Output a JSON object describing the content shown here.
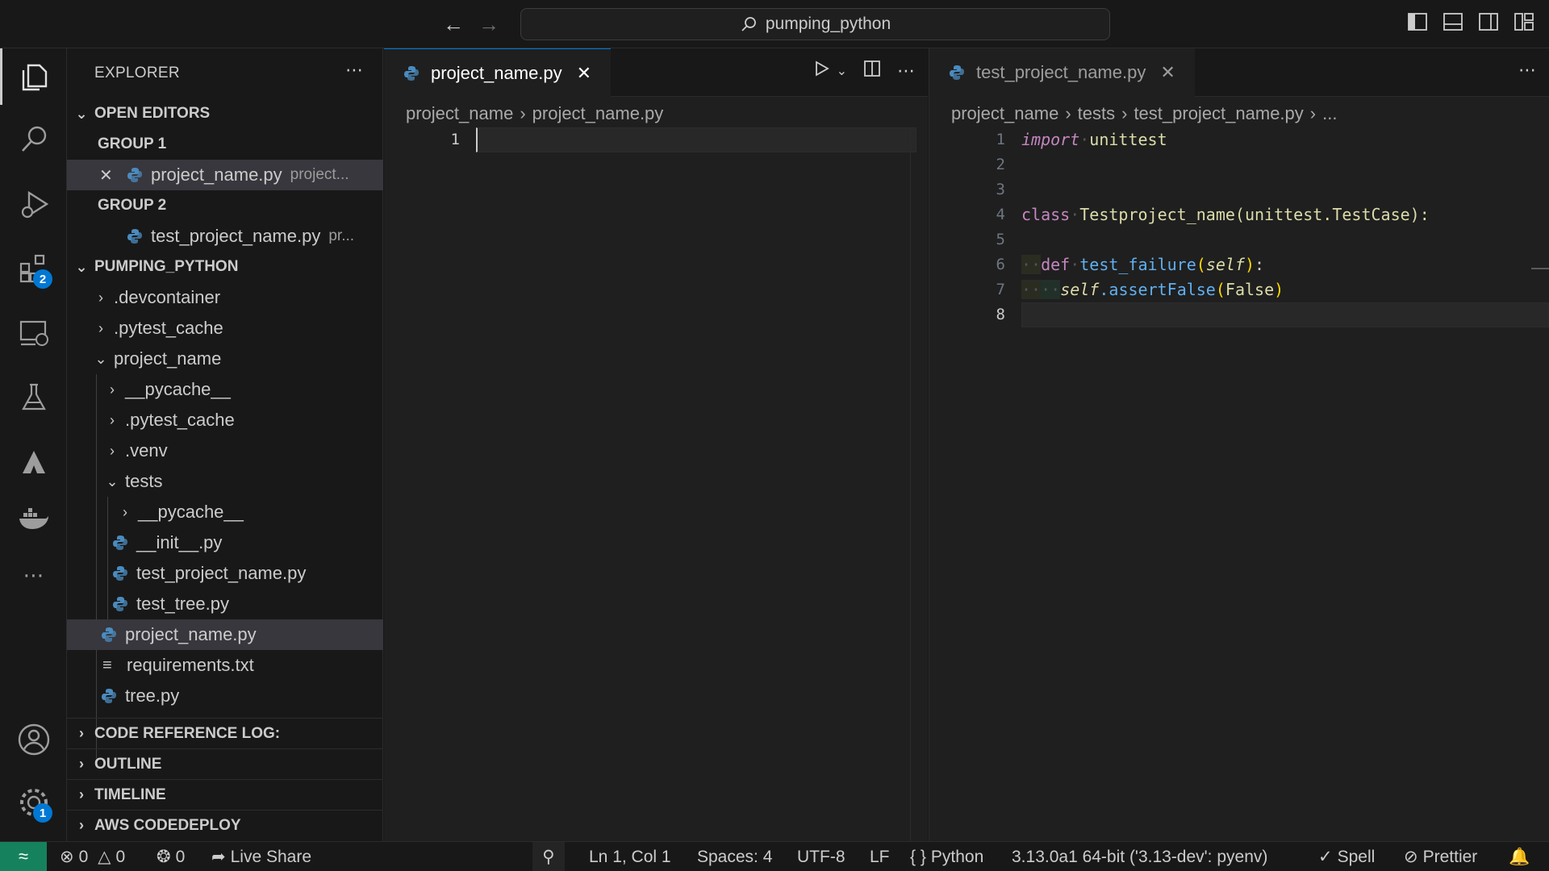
{
  "titlebar": {
    "search_text": "pumping_python",
    "back_icon": "arrow-left-icon",
    "forward_icon": "arrow-right-icon"
  },
  "activitybar": {
    "extensions_badge": "2",
    "settings_badge": "1"
  },
  "sidebar": {
    "title": "EXPLORER",
    "open_editors": {
      "label": "OPEN EDITORS",
      "group1": "GROUP 1",
      "group1_file": "project_name.py",
      "group1_desc": "project...",
      "group2": "GROUP 2",
      "group2_file": "test_project_name.py",
      "group2_desc": "pr..."
    },
    "folder": {
      "label": "PUMPING_PYTHON",
      "items": [
        ".devcontainer",
        ".pytest_cache",
        "project_name",
        "__pycache__",
        ".pytest_cache",
        ".venv",
        "tests",
        "__pycache__",
        "__init__.py",
        "test_project_name.py",
        "test_tree.py",
        "project_name.py",
        "requirements.txt",
        "tree.py"
      ]
    },
    "sections": [
      "CODE REFERENCE LOG:",
      "OUTLINE",
      "TIMELINE",
      "AWS CODEDEPLOY"
    ]
  },
  "editor_left": {
    "tab_label": "project_name.py",
    "breadcrumb": [
      "project_name",
      "project_name.py"
    ],
    "line_numbers": [
      "1"
    ]
  },
  "editor_right": {
    "tab_label": "test_project_name.py",
    "breadcrumb": [
      "project_name",
      "tests",
      "test_project_name.py",
      "..."
    ],
    "line_numbers": [
      "1",
      "2",
      "3",
      "4",
      "5",
      "6",
      "7",
      "8"
    ],
    "code": {
      "l1_kw": "import",
      "l1_mod": "unittest",
      "l4_kw": "class",
      "l4_name": "Testproject_name",
      "l4_base": "(unittest.TestCase):",
      "l6_kw": "def",
      "l6_fn": "test_failure",
      "l6_open": "(",
      "l6_self": "self",
      "l6_close": ")",
      "l6_colon": ":",
      "l7_self": "self",
      "l7_call": ".assertFalse",
      "l7_open": "(",
      "l7_arg": "False",
      "l7_close": ")"
    }
  },
  "statusbar": {
    "errors": "0",
    "warnings": "0",
    "ports": "0",
    "live_share": "Live Share",
    "position": "Ln 1, Col 1",
    "spaces": "Spaces: 4",
    "encoding": "UTF-8",
    "eol": "LF",
    "language": "Python",
    "interpreter": "3.13.0a1 64-bit ('3.13-dev': pyenv)",
    "spell": "Spell",
    "prettier": "Prettier"
  },
  "colors": {
    "accent": "#0078d4",
    "remote": "#16825d",
    "python_icon": "#4b8bbe"
  }
}
